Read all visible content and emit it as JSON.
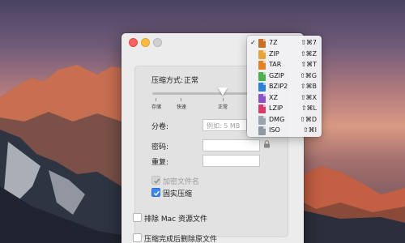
{
  "window": {
    "compression_mode_label": "压缩方式:",
    "compression_mode_value": "正常",
    "slider_ticks": [
      "存储",
      "快速",
      "正常"
    ],
    "slider_level": "正常",
    "split_label": "分卷:",
    "split_placeholder": "例如: 5 MB",
    "password_label": "密码:",
    "repeat_label": "重复:",
    "encrypt_filenames_label": "加密文件名",
    "encrypt_filenames_checked": true,
    "encrypt_filenames_enabled": false,
    "solid_label": "固实压缩",
    "solid_checked": true,
    "exclude_mac_label": "排除 Mac 资源文件",
    "exclude_mac_checked": false,
    "delete_after_label": "压缩完成后删除原文件",
    "delete_after_checked": false
  },
  "format_menu": {
    "selected": "7Z",
    "items": [
      {
        "label": "7Z",
        "shortcut": "⇧⌘7",
        "checked": true,
        "icon": "7z-file-icon",
        "color": "#c8702a"
      },
      {
        "label": "ZIP",
        "shortcut": "⇧⌘Z",
        "checked": false,
        "icon": "zip-file-icon",
        "color": "#e8a33a"
      },
      {
        "label": "TAR",
        "shortcut": "⇧⌘T",
        "checked": false,
        "icon": "tar-file-icon",
        "color": "#e47f2a"
      },
      {
        "label": "GZIP",
        "shortcut": "⇧⌘G",
        "checked": false,
        "icon": "gzip-file-icon",
        "color": "#4caf50"
      },
      {
        "label": "BZIP2",
        "shortcut": "⇧⌘B",
        "checked": false,
        "icon": "bzip2-file-icon",
        "color": "#2f7fd6"
      },
      {
        "label": "XZ",
        "shortcut": "⇧⌘X",
        "checked": false,
        "icon": "xz-file-icon",
        "color": "#8a52c6"
      },
      {
        "label": "LZIP",
        "shortcut": "⇧⌘L",
        "checked": false,
        "icon": "lzip-file-icon",
        "color": "#d63a6a"
      },
      {
        "label": "DMG",
        "shortcut": "⇧⌘D",
        "checked": false,
        "icon": "dmg-file-icon",
        "color": "#9aa4ae"
      },
      {
        "label": "ISO",
        "shortcut": "⇧⌘I",
        "checked": false,
        "icon": "iso-file-icon",
        "color": "#8d98a3"
      }
    ]
  },
  "colors": {
    "accent": "#3b86f2",
    "close": "#fc615d",
    "minimize": "#fdbc40",
    "zoom": "#d0d0d0"
  }
}
